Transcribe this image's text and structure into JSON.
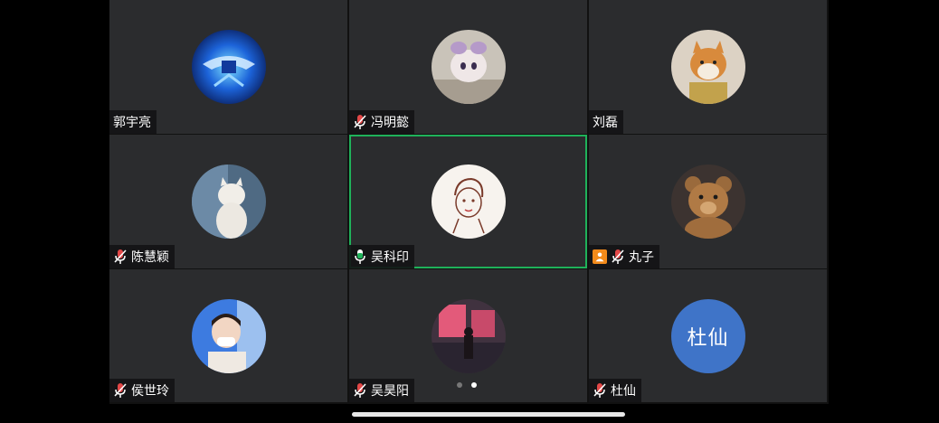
{
  "participants": [
    {
      "name": "郭宇亮",
      "mic": "none",
      "avatar": "gaming-emblem"
    },
    {
      "name": "冯明懿",
      "mic": "muted",
      "avatar": "plush-toy"
    },
    {
      "name": "刘磊",
      "mic": "none",
      "avatar": "shiba-dog"
    },
    {
      "name": "陈慧颖",
      "mic": "muted",
      "avatar": "white-cat"
    },
    {
      "name": "吴科印",
      "mic": "speaking",
      "avatar": "sketch-portrait",
      "active": true
    },
    {
      "name": "丸子",
      "mic": "muted",
      "avatar": "teddy-bear",
      "host": true
    },
    {
      "name": "侯世玲",
      "mic": "muted",
      "avatar": "child-photo"
    },
    {
      "name": "吴昊阳",
      "mic": "muted",
      "avatar": "pink-city"
    },
    {
      "name": "杜仙",
      "mic": "muted",
      "avatar": "initials",
      "initials": "杜仙"
    }
  ],
  "pager": {
    "pages": 2,
    "current": 2
  },
  "colors": {
    "tile_bg": "#2b2c2e",
    "active_border": "#1fb25a",
    "muted_icon": "#e34848",
    "speaking_icon": "#1fb25a",
    "initials_bg": "#3f74c8"
  }
}
